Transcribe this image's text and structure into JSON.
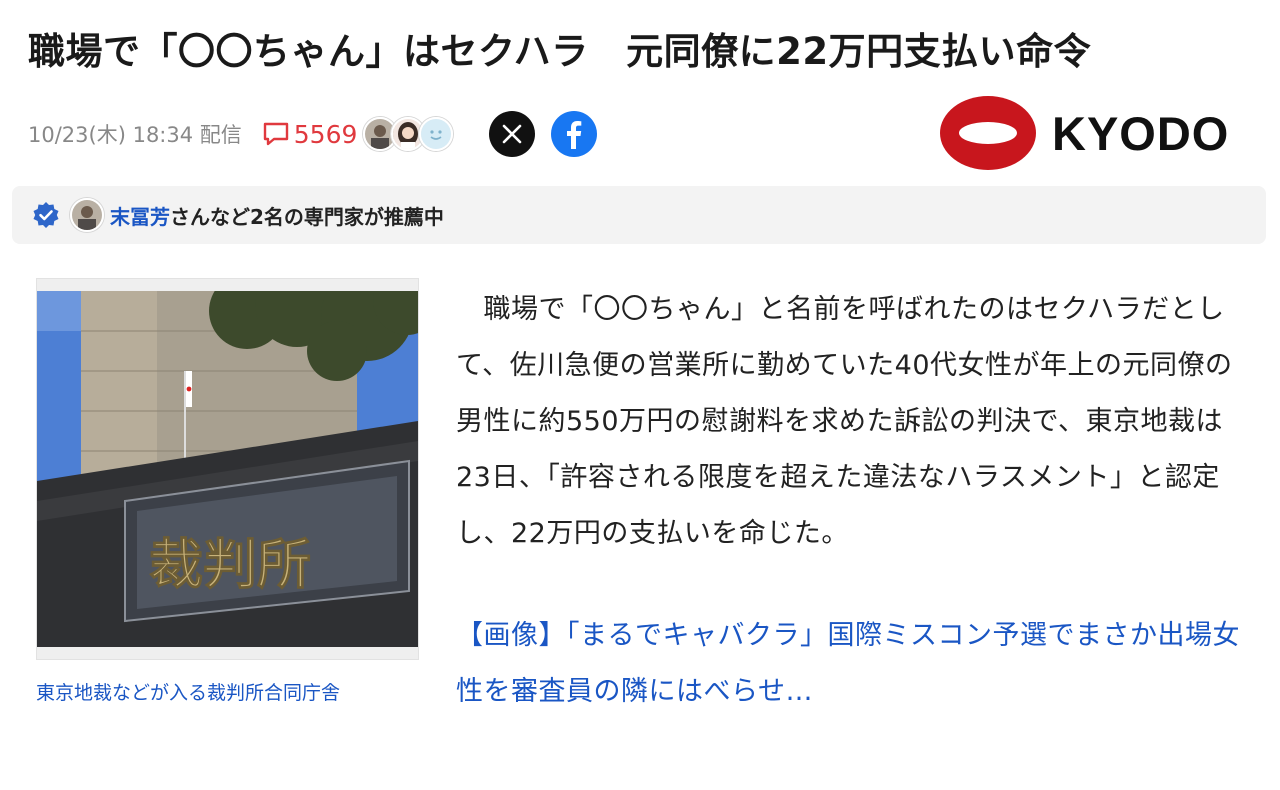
{
  "article": {
    "headline": "職場で「〇〇ちゃん」はセクハラ　元同僚に22万円支払い命令",
    "date": "10/23(木) 18:34 配信",
    "comment_count": "5569",
    "publisher_logo_text": "KYODO",
    "body": "　職場で「〇〇ちゃん」と名前を呼ばれたのはセクハラだとして、佐川急便の営業所に勤めていた40代女性が年上の元同僚の男性に約550万円の慰謝料を求めた訴訟の判決で、東京地裁は23日、「許容される限度を超えた違法なハラスメント」と認定し、22万円の支払いを命じた。",
    "related_link": "【画像】「まるでキャバクラ」国際ミスコン予選でまさか出場女性を審査員の隣にはべらせ…"
  },
  "recommend": {
    "expert_name": "末冨芳",
    "suffix": "さんなど2名の専門家が推薦中"
  },
  "photo": {
    "sign_text": "裁判所",
    "caption": "東京地裁などが入る裁判所合同庁舎"
  },
  "icons": {
    "comment": "speech-bubble-icon",
    "x": "x-logo-icon",
    "facebook": "facebook-icon",
    "verified": "verified-badge-icon"
  },
  "colors": {
    "comment_red": "#e0393e",
    "link_blue": "#1a56c4",
    "kyodo_red": "#c8161d",
    "facebook_blue": "#1877f2"
  }
}
